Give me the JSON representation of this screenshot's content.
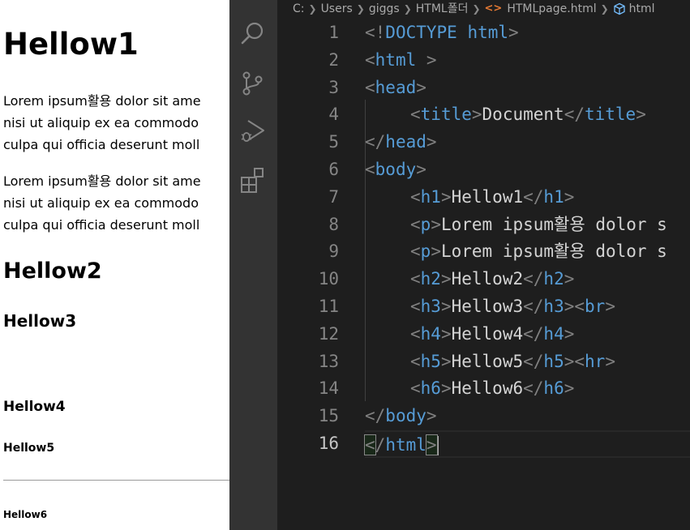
{
  "preview": {
    "h1": "Hellow1",
    "p1_lines": [
      "Lorem ipsum활용 dolor sit ame",
      "nisi ut aliquip ex ea commodo",
      "culpa qui officia deserunt moll"
    ],
    "p2_lines": [
      "Lorem ipsum활용 dolor sit ame",
      "nisi ut aliquip ex ea commodo",
      "culpa qui officia deserunt moll"
    ],
    "h2": "Hellow2",
    "h3": "Hellow3",
    "h4": "Hellow4",
    "h5": "Hellow5",
    "h6": "Hellow6"
  },
  "activity_bar": {
    "icons": [
      "search-icon",
      "source-control-icon",
      "run-debug-icon",
      "extensions-icon"
    ],
    "icon_color": "#858585"
  },
  "breadcrumb": {
    "items": [
      "C:",
      "Users",
      "giggs",
      "HTML폴더",
      "HTMLpage.html",
      "html"
    ]
  },
  "editor": {
    "current_line": 16,
    "line_numbers": [
      "1",
      "2",
      "3",
      "4",
      "5",
      "6",
      "7",
      "8",
      "9",
      "10",
      "11",
      "12",
      "13",
      "14",
      "15",
      "16"
    ],
    "lines": {
      "l1": {
        "a": "<!",
        "b": "DOCTYPE",
        "c": " ",
        "d": "html",
        "e": ">"
      },
      "l2": {
        "a": "<",
        "b": "html",
        "c": " >"
      },
      "l3": {
        "a": "<",
        "b": "head",
        "c": ">"
      },
      "l4": {
        "a": "<",
        "b": "title",
        "c": ">",
        "d": "Document",
        "e": "</",
        "f": "title",
        "g": ">"
      },
      "l5": {
        "a": "</",
        "b": "head",
        "c": ">"
      },
      "l6": {
        "a": "<",
        "b": "body",
        "c": ">"
      },
      "l7": {
        "a": "<",
        "b": "h1",
        "c": ">",
        "d": "Hellow1",
        "e": "</",
        "f": "h1",
        "g": ">"
      },
      "l8": {
        "a": "<",
        "b": "p",
        "c": ">",
        "d": "Lorem ipsum활용 dolor s"
      },
      "l9": {
        "a": "<",
        "b": "p",
        "c": ">",
        "d": "Lorem ipsum활용 dolor s"
      },
      "l10": {
        "a": "<",
        "b": "h2",
        "c": ">",
        "d": "Hellow2",
        "e": "</",
        "f": "h2",
        "g": ">"
      },
      "l11": {
        "a": "<",
        "b": "h3",
        "c": ">",
        "d": "Hellow3",
        "e": "</",
        "f": "h3",
        "g": "><",
        "h": "br",
        "i": ">"
      },
      "l12": {
        "a": "<",
        "b": "h4",
        "c": ">",
        "d": "Hellow4",
        "e": "</",
        "f": "h4",
        "g": ">"
      },
      "l13": {
        "a": "<",
        "b": "h5",
        "c": ">",
        "d": "Hellow5",
        "e": "</",
        "f": "h5",
        "g": "><",
        "h": "hr",
        "i": ">"
      },
      "l14": {
        "a": "<",
        "b": "h6",
        "c": ">",
        "d": "Hellow6",
        "e": "</",
        "f": "h6",
        "g": ">"
      },
      "l15": {
        "a": "</",
        "b": "body",
        "c": ">"
      },
      "l16": {
        "a": "<",
        "b": "/",
        "c": "html",
        "d": ">"
      }
    }
  },
  "colors": {
    "editor_bg": "#1e1e1e",
    "activity_bar_bg": "#333333",
    "tag": "#569cd6",
    "punctuation": "#808080",
    "text": "#d4d4d4",
    "line_number": "#858585",
    "current_line_number": "#c6c6c6"
  }
}
